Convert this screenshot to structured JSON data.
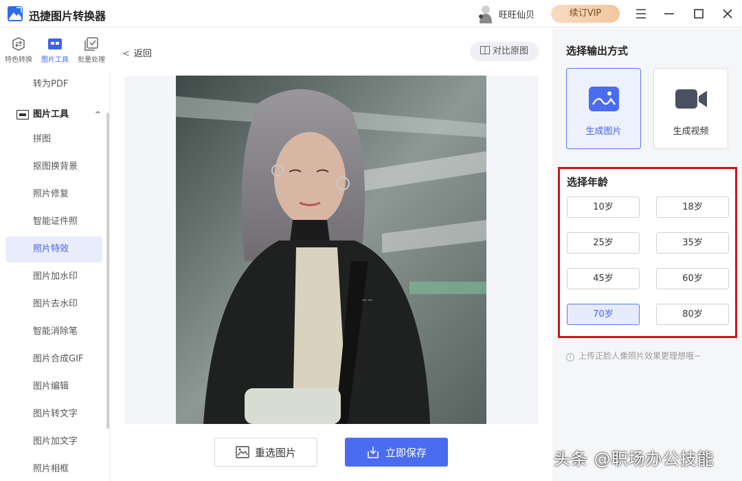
{
  "app": {
    "title": "迅捷图片转换器",
    "username": "旺旺仙贝",
    "vip_label": "续订VIP"
  },
  "rail": [
    {
      "label": "特色转换",
      "icon": "convert-icon"
    },
    {
      "label": "图片工具",
      "icon": "image-tools-icon",
      "active": true
    },
    {
      "label": "批量处理",
      "icon": "batch-icon"
    }
  ],
  "sidebar": {
    "top_item": "转为PDF",
    "group_label": "图片工具",
    "items": [
      {
        "label": "拼图"
      },
      {
        "label": "抠图换背景"
      },
      {
        "label": "照片修复"
      },
      {
        "label": "智能证件照"
      },
      {
        "label": "照片特效",
        "active": true
      },
      {
        "label": "图片加水印"
      },
      {
        "label": "图片去水印"
      },
      {
        "label": "智能消除笔"
      },
      {
        "label": "图片合成GIF"
      },
      {
        "label": "图片编辑"
      },
      {
        "label": "图片转文字"
      },
      {
        "label": "图片加文字"
      },
      {
        "label": "照片相框"
      }
    ]
  },
  "main": {
    "back_label": "返回",
    "compare_label": "对比原图",
    "reselect_label": "重选图片",
    "save_label": "立即保存"
  },
  "right": {
    "output_heading": "选择输出方式",
    "output_options": [
      {
        "label": "生成图片",
        "icon": "image-icon",
        "active": true
      },
      {
        "label": "生成视频",
        "icon": "video-camera-icon"
      }
    ],
    "age_heading": "选择年龄",
    "ages": [
      "10岁",
      "18岁",
      "25岁",
      "35岁",
      "45岁",
      "60岁",
      "70岁",
      "80岁"
    ],
    "selected_age": "70岁",
    "tip": "上传正脸人像照片效果更理想哦~"
  },
  "watermark": "头条 @职场办公技能",
  "colors": {
    "accent": "#4a6cf0",
    "highlight_border": "#c8161d",
    "vip": "#f2c79d"
  }
}
